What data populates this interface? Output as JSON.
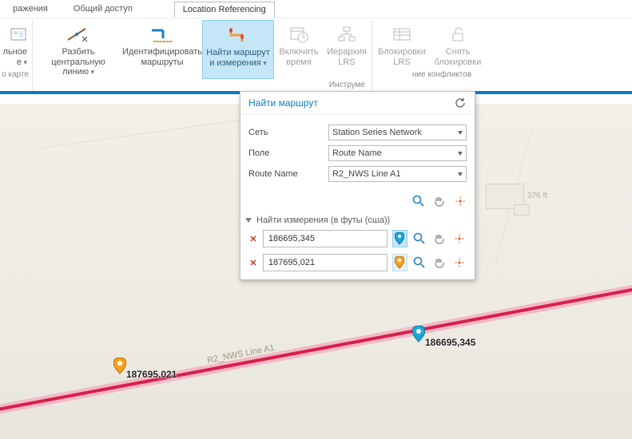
{
  "ribbon": {
    "tabs": {
      "t1": "ражения",
      "t2": "Общий доступ",
      "t3": "Location Referencing"
    },
    "buttons": {
      "b0a": "льное",
      "b0b": "е",
      "b1a": "Разбить центральную",
      "b1b": "линию",
      "b2a": "Идентифицировать",
      "b2b": "маршруты",
      "b3a": "Найти маршрут",
      "b3b": "и измерения",
      "b4a": "Включить",
      "b4b": "время",
      "b5a": "Иерархия",
      "b5b": "LRS",
      "b6a": "Блокировки",
      "b6b": "LRS",
      "b7a": "Снять",
      "b7b": "блокировки"
    },
    "groups": {
      "g0": "о карте",
      "g1": "Инструме",
      "g2": "ние конфликтов"
    }
  },
  "panel": {
    "title": "Найти маршрут",
    "network_label": "Сеть",
    "network_value": "Station Series Network",
    "field_label": "Поле",
    "field_value": "Route Name",
    "route_label": "Route Name",
    "route_value": "R2_NWS Line A1",
    "measures_title": "Найти измерения (в футы (сша))",
    "m1": "186695,345",
    "m2": "187695,021"
  },
  "map": {
    "route_text": "R2_NWS Line A1",
    "pin1_label": "186695,345",
    "pin2_label": "187695,021",
    "elev": "376 ft"
  }
}
